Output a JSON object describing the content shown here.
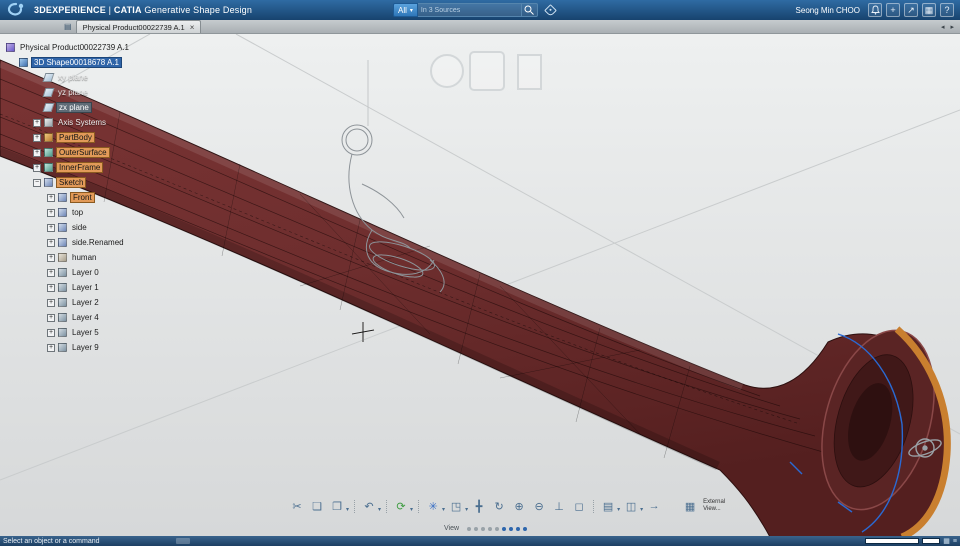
{
  "header": {
    "brand": "3DEXPERIENCE",
    "pipe": "|",
    "app": "CATIA",
    "workbench": "Generative Shape Design",
    "search_filter": "All",
    "search_caret": "▾",
    "search_placeholder": "In 3 Sources",
    "user": "Seong Min CHOO",
    "icons": {
      "plus": "+",
      "share": "↗",
      "apps": "▦",
      "help": "?"
    }
  },
  "tabbar": {
    "doc_icon": "▤",
    "active_tab": "Physical Product00022739 A.1",
    "close": "×",
    "nav": "◂ ▸"
  },
  "tree": {
    "plus": "+",
    "minus": "−",
    "root": {
      "label": "Physical Product00022739 A.1"
    },
    "items": [
      {
        "label": "3D Shape00018678 A.1"
      },
      {
        "label": "xy plane"
      },
      {
        "label": "yz plane"
      },
      {
        "label": "zx plane"
      },
      {
        "label": "Axis Systems"
      },
      {
        "label": "PartBody"
      },
      {
        "label": "OuterSurface"
      },
      {
        "label": "InnerFrame"
      },
      {
        "label": "Sketch"
      },
      {
        "label": "Front"
      },
      {
        "label": "top"
      },
      {
        "label": "side"
      },
      {
        "label": "side.Renamed"
      },
      {
        "label": "human"
      },
      {
        "label": "Layer 0"
      },
      {
        "label": "Layer 1"
      },
      {
        "label": "Layer 2"
      },
      {
        "label": "Layer 4"
      },
      {
        "label": "Layer 5"
      },
      {
        "label": "Layer 9"
      }
    ]
  },
  "toolbar": {
    "dd": "▾",
    "icons": [
      {
        "name": "cut",
        "glyph": "✂"
      },
      {
        "name": "copy",
        "glyph": "❏"
      },
      {
        "name": "paste",
        "glyph": "❐"
      },
      {
        "name": "undo",
        "glyph": "↶"
      },
      {
        "name": "update",
        "glyph": "⟳"
      },
      {
        "name": "frame",
        "glyph": "✳"
      },
      {
        "name": "iso-view",
        "glyph": "◳"
      },
      {
        "name": "pan",
        "glyph": "╋"
      },
      {
        "name": "rotate",
        "glyph": "↻"
      },
      {
        "name": "zoom-in",
        "glyph": "⊕"
      },
      {
        "name": "zoom-out",
        "glyph": "⊖"
      },
      {
        "name": "normal-view",
        "glyph": "⊥"
      },
      {
        "name": "cube",
        "glyph": "◻"
      },
      {
        "name": "list",
        "glyph": "▤"
      },
      {
        "name": "panes",
        "glyph": "◫"
      },
      {
        "name": "next",
        "glyph": "→"
      },
      {
        "name": "external",
        "glyph": "▦"
      }
    ],
    "view_label": "View",
    "external1": "External",
    "external2": "View..."
  },
  "statusbar": {
    "message": "Select an object or a command",
    "icons": {
      "grid": "▦",
      "menu": "≡"
    }
  },
  "colors": {
    "header_blue": "#2f6ba3",
    "model_maroon": "#6e3030",
    "bell_orange": "#c97f2f",
    "highlight_orange": "#e29a58",
    "selection_blue": "#2f64a8"
  }
}
